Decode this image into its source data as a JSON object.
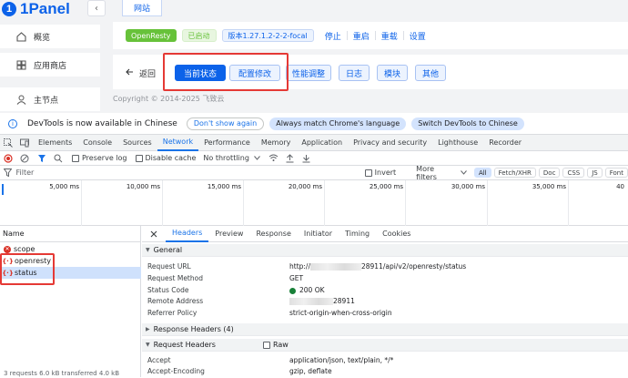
{
  "app": {
    "logo_text": "1Panel",
    "logo_mark": "1",
    "collapse_icon": "‹",
    "nav": [
      {
        "label": "概览",
        "icon": "home-icon"
      },
      {
        "label": "应用商店",
        "icon": "grid-icon"
      },
      {
        "label": "主节点",
        "icon": "user-icon"
      }
    ],
    "top_tab": "网站",
    "toolbar": {
      "app_tag": "OpenResty",
      "status_tag": "已启动",
      "version_tag": "版本1.27.1.2-2-2-focal",
      "actions": [
        "停止",
        "重启",
        "重载",
        "设置"
      ]
    },
    "subbar": {
      "back_label": "返回",
      "buttons": [
        "当前状态",
        "配置修改",
        "性能调整",
        "日志",
        "模块",
        "其他"
      ]
    },
    "copyright": "Copyright © 2014-2025 飞致云"
  },
  "devtools": {
    "infobar": {
      "message": "DevTools is now available in Chinese",
      "dismiss": "Don't show again",
      "match": "Always match Chrome's language",
      "switch": "Switch DevTools to Chinese"
    },
    "tabs": [
      "Elements",
      "Console",
      "Sources",
      "Network",
      "Performance",
      "Memory",
      "Application",
      "Privacy and security",
      "Lighthouse",
      "Recorder"
    ],
    "active_tab": "Network",
    "network_toolbar": {
      "preserve_log": "Preserve log",
      "disable_cache": "Disable cache",
      "throttling": "No throttling"
    },
    "filter": {
      "placeholder": "Filter",
      "invert": "Invert",
      "more_filters": "More filters",
      "types": [
        "All",
        "Fetch/XHR",
        "Doc",
        "CSS",
        "JS",
        "Font"
      ]
    },
    "timeline_ticks": [
      "5,000 ms",
      "10,000 ms",
      "15,000 ms",
      "20,000 ms",
      "25,000 ms",
      "30,000 ms",
      "35,000 ms",
      "40"
    ],
    "requests_header": "Name",
    "requests": [
      {
        "name": "scope",
        "kind": "error"
      },
      {
        "name": "openresty",
        "kind": "xhr"
      },
      {
        "name": "status",
        "kind": "xhr"
      }
    ],
    "summary": "3 requests   6.0 kB transferred   4.0 kB",
    "detail_tabs": [
      "Headers",
      "Preview",
      "Response",
      "Initiator",
      "Timing",
      "Cookies"
    ],
    "general": {
      "title": "General",
      "rows": [
        {
          "key": "Request URL",
          "value_prefix": "http://",
          "value_suffix": "28911/api/v2/openresty/status"
        },
        {
          "key": "Request Method",
          "value": "GET"
        },
        {
          "key": "Status Code",
          "value": "200 OK"
        },
        {
          "key": "Remote Address",
          "value_suffix": "28911"
        },
        {
          "key": "Referrer Policy",
          "value": "strict-origin-when-cross-origin"
        }
      ]
    },
    "response_headers": "Response Headers (4)",
    "request_headers": {
      "title": "Request Headers",
      "raw": "Raw",
      "rows": [
        {
          "key": "Accept",
          "value": "application/json, text/plain, */*"
        },
        {
          "key": "Accept-Encoding",
          "value": "gzip, deflate"
        }
      ]
    }
  }
}
